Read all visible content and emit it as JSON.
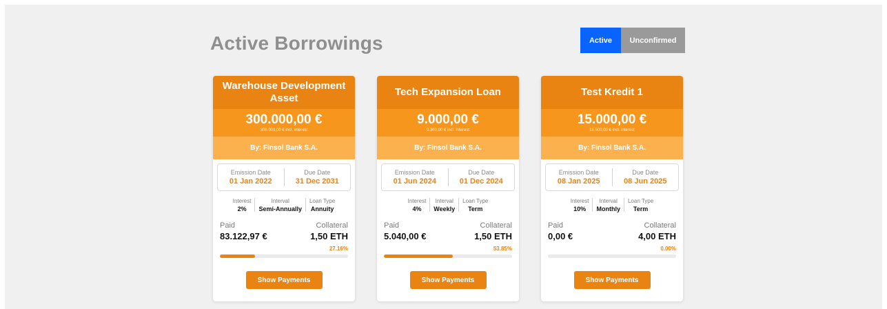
{
  "header": {
    "title": "Active Borrowings"
  },
  "toggle": {
    "active_label": "Active",
    "unconfirmed_label": "Unconfirmed"
  },
  "colors": {
    "accent": "#e98312",
    "active_blue": "#0a64ff",
    "inactive_gray": "#9a9a9a"
  },
  "cards": [
    {
      "title": "Warehouse Development Asset",
      "amount": "300.000,00 €",
      "interest_note": "306.000,00 € incl. interest",
      "by": "By: Finsol Bank S.A.",
      "emission_label": "Emission Date",
      "emission_date": "01 Jan 2022",
      "due_label": "Due Date",
      "due_date": "31 Dec 2031",
      "interest_label": "Interest",
      "interest": "2%",
      "interval_label": "Interval",
      "interval": "Semi-Annually",
      "loan_type_label": "Loan Type",
      "loan_type": "Annuity",
      "paid_label": "Paid",
      "paid": "83.122,97 €",
      "collateral_label": "Collateral",
      "collateral": "1,50 ETH",
      "progress_percent": "27.16%",
      "progress_fraction": 0.2716,
      "button_label": "Show Payments"
    },
    {
      "title": "Tech Expansion Loan",
      "amount": "9.000,00 €",
      "interest_note": "9.360,00 € incl. interest",
      "by": "By: Finsol Bank S.A.",
      "emission_label": "Emission Date",
      "emission_date": "01 Jun 2024",
      "due_label": "Due Date",
      "due_date": "01 Dec 2024",
      "interest_label": "Interest",
      "interest": "4%",
      "interval_label": "Interval",
      "interval": "Weekly",
      "loan_type_label": "Loan Type",
      "loan_type": "Term",
      "paid_label": "Paid",
      "paid": "5.040,00 €",
      "collateral_label": "Collateral",
      "collateral": "1,50 ETH",
      "progress_percent": "53.85%",
      "progress_fraction": 0.5385,
      "button_label": "Show Payments"
    },
    {
      "title": "Test Kredit 1",
      "amount": "15.000,00 €",
      "interest_note": "16.500,00 € incl. interest",
      "by": "By: Finsol Bank S.A.",
      "emission_label": "Emission Date",
      "emission_date": "08 Jan 2025",
      "due_label": "Due Date",
      "due_date": "08 Jun 2025",
      "interest_label": "Interest",
      "interest": "10%",
      "interval_label": "Interval",
      "interval": "Monthly",
      "loan_type_label": "Loan Type",
      "loan_type": "Term",
      "paid_label": "Paid",
      "paid": "0,00 €",
      "collateral_label": "Collateral",
      "collateral": "4,00 ETH",
      "progress_percent": "0.00%",
      "progress_fraction": 0,
      "button_label": "Show Payments"
    }
  ]
}
